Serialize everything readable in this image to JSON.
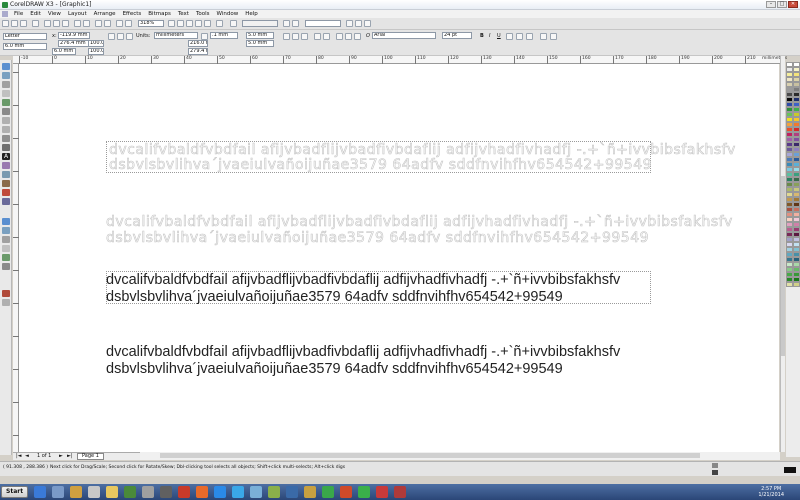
{
  "window": {
    "title": "CorelDRAW X3 - [Graphic1]"
  },
  "menu": [
    "File",
    "Edit",
    "View",
    "Layout",
    "Arrange",
    "Effects",
    "Bitmaps",
    "Text",
    "Tools",
    "Window",
    "Help"
  ],
  "toolbar": {
    "zoom": "318%",
    "paper": "Letter",
    "pos_x": "-119.9 mm",
    "pos_y": "276.4 mm",
    "size_w": "6.0 mm",
    "size_h": "6.0 mm",
    "scale_w": "100.0",
    "scale_h": "100.0",
    "units_label": "Units:",
    "units_value": "millimeters",
    "nudge": ".1 mm",
    "dup_h": "5.0 mm",
    "dup_v": "5.0 mm",
    "width_value": "216.0 mm",
    "height_value": "279.4 mm",
    "font_name": "Arial",
    "font_size": "24 pt"
  },
  "ruler": {
    "unit": "millimeters",
    "ticks": [
      "-10",
      "0",
      "10",
      "20",
      "30",
      "40",
      "50",
      "60",
      "70",
      "80",
      "90",
      "100",
      "110",
      "120",
      "130",
      "140",
      "150",
      "160",
      "170",
      "180",
      "190",
      "200",
      "210"
    ]
  },
  "canvas": {
    "line1": "dvcalifvbaldfvbdfail afijvbadflijvbadfivbdaflij adfijvhadfivhadfj  -.+`ñ+ivvbibsfakhsfv",
    "line2": "dsbvlsbvlihva´jvaeiulvañoijuñae3579 64adfv sddfnvihfhv654542+99549"
  },
  "pages": {
    "counter": "1 of 1",
    "tab": "Page 1"
  },
  "status": {
    "coords": "( 91.308 , 288.386 )",
    "hint": "Next click for Drag/Scale; Second click for Rotate/Skew; Dbl-clicking tool selects all objects; Shift+click multi-selects; Alt+click digs"
  },
  "taskbar": {
    "start": "Start",
    "time": "2:57 PM",
    "date": "1/21/2014"
  },
  "palette_colors": [
    "#ffffff",
    "#ffffff",
    "#e8e8e8",
    "#f6f3c8",
    "#f5ee9c",
    "#f3e27a",
    "#efe6c5",
    "#dcd3a8",
    "#d8d0b0",
    "#c8c0a0",
    "#9a9a9a",
    "#7d7d7d",
    "#4a4a4a",
    "#2a2a2a",
    "#0a0a0a",
    "#1f2f6e",
    "#2e4aa8",
    "#3f62c8",
    "#2f8f3a",
    "#3fb04a",
    "#67c35a",
    "#c9c92a",
    "#f0e020",
    "#f6c62a",
    "#f2a13a",
    "#f27a2e",
    "#e8502a",
    "#d42a2a",
    "#c02060",
    "#b04080",
    "#a060a8",
    "#8050a0",
    "#5a3a8a",
    "#3a2a6a",
    "#6a5a9a",
    "#8e80c0",
    "#a6a6d8",
    "#6aa0d8",
    "#4a7ab8",
    "#2a5a98",
    "#3a8ab8",
    "#5ab0d8",
    "#7ac8e0",
    "#9adce8",
    "#5ac0a0",
    "#3aa080",
    "#2a8060",
    "#3a6a4a",
    "#6a8a4a",
    "#8aa05a",
    "#aab86a",
    "#c8c880",
    "#e0d890",
    "#d8b870",
    "#c09850",
    "#a07838",
    "#805828",
    "#603818",
    "#a85040",
    "#c87060",
    "#e09080",
    "#f0b0a0",
    "#f8d0c0",
    "#f0c8d8",
    "#e0a0c0",
    "#d080a8",
    "#b86090",
    "#983a70",
    "#782a58",
    "#5a1a40",
    "#a0a0c8",
    "#c0c0e0",
    "#d8d8f0",
    "#c0e0f0",
    "#a0d0e0",
    "#80c0d0",
    "#60a8c0",
    "#4890a8",
    "#387890",
    "#286078",
    "#c8e8c8",
    "#a8d8a8",
    "#88c888",
    "#68b868",
    "#48a848",
    "#389838",
    "#288828",
    "#187818",
    "#e0e0a8",
    "#d0d088"
  ]
}
